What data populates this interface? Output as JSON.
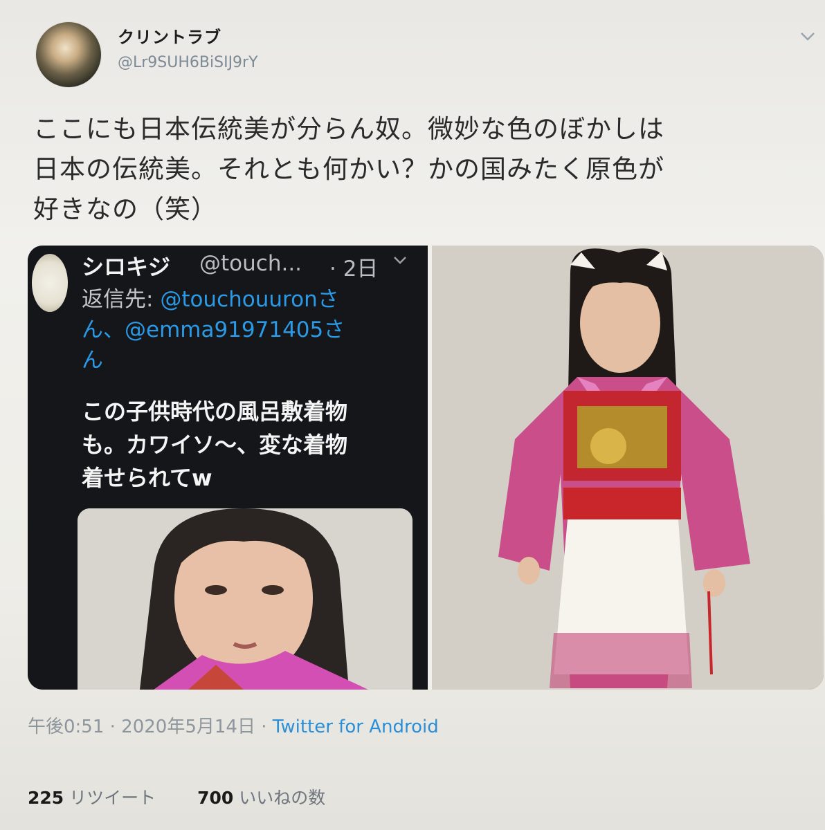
{
  "tweet": {
    "author": {
      "display_name": "クリントラブ",
      "handle": "@Lr9SUH6BiSIJ9rY"
    },
    "text_lines": [
      "ここにも日本伝統美が分らん奴。微妙な色のぼかしは",
      "日本の伝統美。それとも何かい？かの国みたく原色が",
      "好きなの（笑）"
    ],
    "quoted": {
      "display_name": "シロキジ",
      "handle": "@touch...",
      "time": "· 2日",
      "reply_prefix": "返信先: ",
      "reply_mention_1": "@touchouuron",
      "reply_joiner_1": "さ",
      "reply_line2_prefix": "ん、",
      "reply_mention_2": "@emma91971405",
      "reply_joiner_2": "さ",
      "reply_line3": "ん",
      "body_lines": [
        "この子供時代の風呂敷着物",
        "も。カワイソ〜、変な着物",
        "着せられてw"
      ]
    },
    "meta": {
      "time": "午後0:51 · 2020年5月14日 · ",
      "source": "Twitter for Android"
    },
    "stats": {
      "retweets_count": "225",
      "retweets_label": "リツイート",
      "likes_count": "700",
      "likes_label": "いいねの数"
    }
  },
  "icons": {
    "caret": "chevron-down-icon",
    "quoted_caret": "chevron-down-icon"
  },
  "colors": {
    "link": "#2a9ae6",
    "muted": "#7d8a96",
    "kimono_pink": "#c94e8a",
    "obi_red": "#c8262b"
  }
}
